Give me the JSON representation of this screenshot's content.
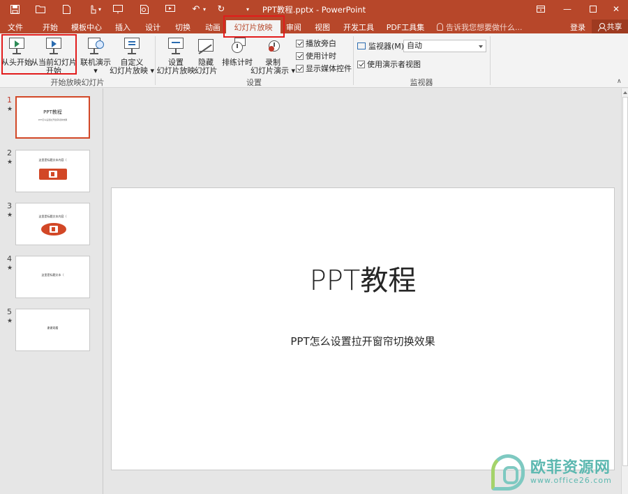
{
  "window": {
    "title": "PPT教程.pptx - PowerPoint"
  },
  "tabs": [
    {
      "label": "文件"
    },
    {
      "label": "开始"
    },
    {
      "label": "模板中心"
    },
    {
      "label": "插入"
    },
    {
      "label": "设计"
    },
    {
      "label": "切换"
    },
    {
      "label": "动画"
    },
    {
      "label": "幻灯片放映"
    },
    {
      "label": "审阅"
    },
    {
      "label": "视图"
    },
    {
      "label": "开发工具"
    },
    {
      "label": "PDF工具集"
    }
  ],
  "tell_me": {
    "placeholder": "告诉我您想要做什么..."
  },
  "account": {
    "signin": "登录",
    "share": "共享"
  },
  "ribbon": {
    "from_beginning": "从头开始",
    "from_current_1": "从当前幻灯片",
    "from_current_2": "开始",
    "online_present": "联机演示",
    "custom_1": "自定义",
    "custom_2": "幻灯片放映",
    "group_start": "开始放映幻灯片",
    "setup_1": "设置",
    "setup_2": "幻灯片放映",
    "hide_1": "隐藏",
    "hide_2": "幻灯片",
    "rehearse": "排练计时",
    "record_1": "录制",
    "record_2": "幻灯片演示",
    "play_narrations": "播放旁白",
    "use_timings": "使用计时",
    "show_media": "显示媒体控件",
    "group_setup": "设置",
    "monitor_label": "监视器(M):",
    "monitor_value": "自动",
    "presenter_view": "使用演示者视图",
    "group_monitors": "监视器"
  },
  "thumbnails": [
    {
      "num": "1",
      "star": "★",
      "title": "PPT教程",
      "sub": "PPT怎么设置拉开窗帘切换效果"
    },
    {
      "num": "2",
      "star": "★",
      "title": "这里是标题文本内容（",
      "sub": ""
    },
    {
      "num": "3",
      "star": "★",
      "title": "这里是标题文本内容（",
      "sub": ""
    },
    {
      "num": "4",
      "star": "★",
      "title": "这里是标题文本（",
      "sub": ""
    },
    {
      "num": "5",
      "star": "★",
      "title": "谢谢观看",
      "sub": ""
    }
  ],
  "slide": {
    "title": "PPT教程",
    "subtitle": "PPT怎么设置拉开窗帘切换效果"
  },
  "watermark": {
    "name": "欧菲资源网",
    "url": "www.office26.com"
  },
  "colors": {
    "accent": "#b7472a",
    "highlight": "#e21b1b"
  }
}
